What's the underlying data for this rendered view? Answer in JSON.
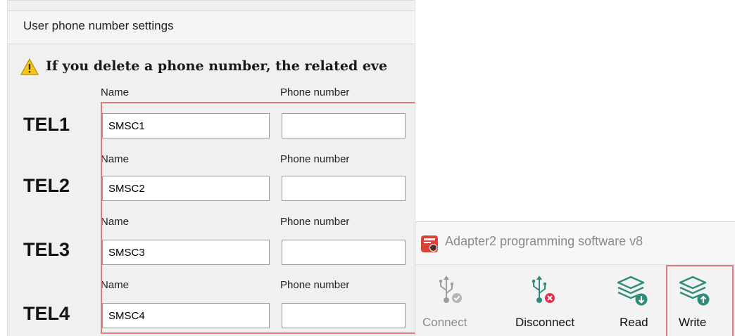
{
  "settings": {
    "title": "User phone number settings",
    "warning": "If you delete a phone number, the related eve",
    "entries": [
      {
        "tel": "TEL1",
        "name_label": "Name",
        "phone_label": "Phone number",
        "name_value": "SMSC1",
        "phone_value": ""
      },
      {
        "tel": "TEL2",
        "name_label": "Name",
        "phone_label": "Phone number",
        "name_value": "SMSC2",
        "phone_value": ""
      },
      {
        "tel": "TEL3",
        "name_label": "Name",
        "phone_label": "Phone number",
        "name_value": "SMSC3",
        "phone_value": ""
      },
      {
        "tel": "TEL4",
        "name_label": "Name",
        "phone_label": "Phone number",
        "name_value": "SMSC4",
        "phone_value": ""
      }
    ]
  },
  "app": {
    "title": "Adapter2 programming software v8",
    "toolbar": {
      "connect": "Connect",
      "disconnect": "Disconnect",
      "read": "Read",
      "write": "Write"
    }
  },
  "colors": {
    "highlight": "#e47b7b",
    "accent_teal": "#2e8b7a",
    "error_red": "#e0304e",
    "warning_yellow": "#f5c518"
  },
  "icons": {
    "warning": "warning-triangle-icon",
    "connect": "usb-connect-icon",
    "disconnect": "usb-disconnect-icon",
    "read": "layers-read-icon",
    "write": "layers-write-icon"
  }
}
